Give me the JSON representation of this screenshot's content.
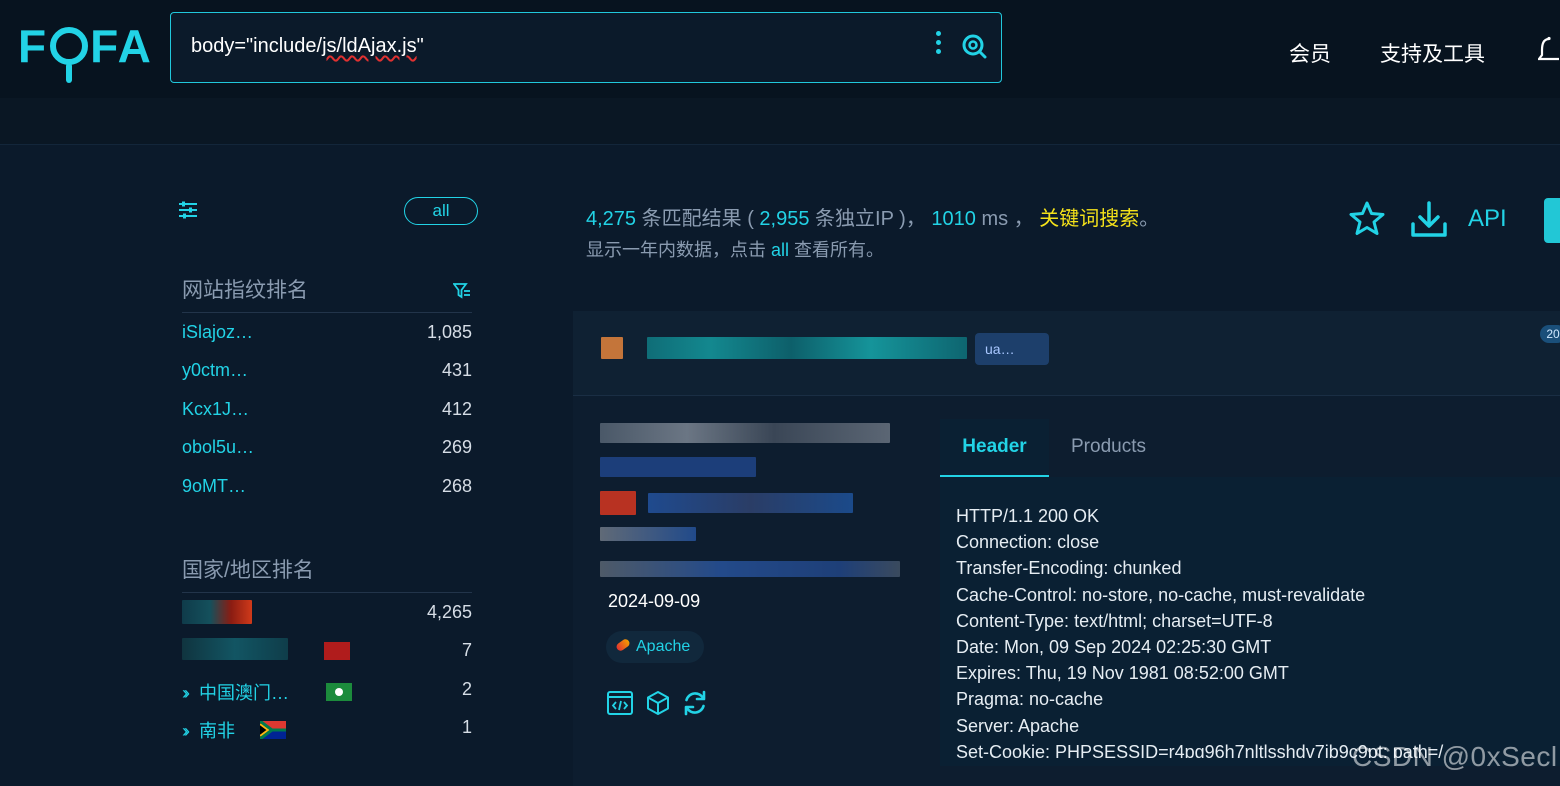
{
  "logo": {
    "text": "FOFA"
  },
  "search": {
    "query": "body=\"include/js/ldAjax.js\"",
    "query_pre": "body=\"include/",
    "query_underlined": "js/ldAjax.js",
    "query_post": "\""
  },
  "nav": {
    "member": "会员",
    "tools": "支持及工具"
  },
  "sidebar": {
    "all_label": "all",
    "fingerprint_title": "网站指纹排名",
    "fingerprints": [
      {
        "name": "iSlajoz…",
        "count": "1,085"
      },
      {
        "name": "y0ctm…",
        "count": "431"
      },
      {
        "name": "Kcx1J…",
        "count": "412"
      },
      {
        "name": "obol5u…",
        "count": "269"
      },
      {
        "name": "9oMT…",
        "count": "268"
      }
    ],
    "country_title": "国家/地区排名",
    "countries": [
      {
        "name": "",
        "count": "4,265"
      },
      {
        "name": "",
        "count": "7"
      },
      {
        "name": "中国澳门…",
        "count": "2"
      },
      {
        "name": "南非",
        "count": "1"
      }
    ]
  },
  "results": {
    "count": "4,275",
    "count_label": "条匹配结果",
    "ip_count": "2,955",
    "ip_label": "条独立IP",
    "time": "1010",
    "time_unit": "ms",
    "keyword_label": "关键词搜索",
    "note_pre": "显示一年内数据，点击",
    "note_all": "all",
    "note_post": "查看所有。",
    "api_label": "API"
  },
  "card": {
    "badge": "20",
    "tag_chip": "ua…",
    "date": "2024-09-09",
    "server_tag": "Apache",
    "tabs": [
      "Header",
      "Products"
    ],
    "header_lines": [
      "HTTP/1.1 200 OK",
      "Connection: close",
      "Transfer-Encoding: chunked",
      "Cache-Control: no-store, no-cache, must-revalidate",
      "Content-Type: text/html; charset=UTF-8",
      "Date: Mon, 09 Sep 2024 02:25:30 GMT",
      "Expires: Thu, 19 Nov 1981 08:52:00 GMT",
      "Pragma: no-cache",
      "Server: Apache",
      "Set-Cookie: PHPSESSID=r4pg96h7nltlsshdv7ib9c9pt; path=/"
    ]
  },
  "watermark": "CSDN @0xSecl",
  "colors": {
    "accent": "#22d3e6",
    "keyword": "#f5e21a",
    "background": "#0b1a2b"
  }
}
